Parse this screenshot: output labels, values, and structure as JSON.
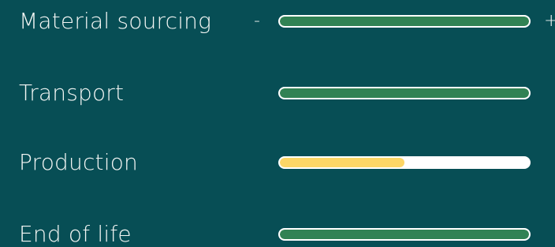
{
  "scale": {
    "min_label": "-",
    "max_label": "+"
  },
  "colors": {
    "background": "#074e55",
    "track": "#ffffff",
    "good": "#318254",
    "medium": "#fcd666"
  },
  "rows": [
    {
      "label": "Material sourcing",
      "level": 1.0,
      "status": "good"
    },
    {
      "label": "Transport",
      "level": 1.0,
      "status": "good"
    },
    {
      "label": "Production",
      "level": 0.5,
      "status": "medium"
    },
    {
      "label": "End of life",
      "level": 1.0,
      "status": "good"
    }
  ]
}
